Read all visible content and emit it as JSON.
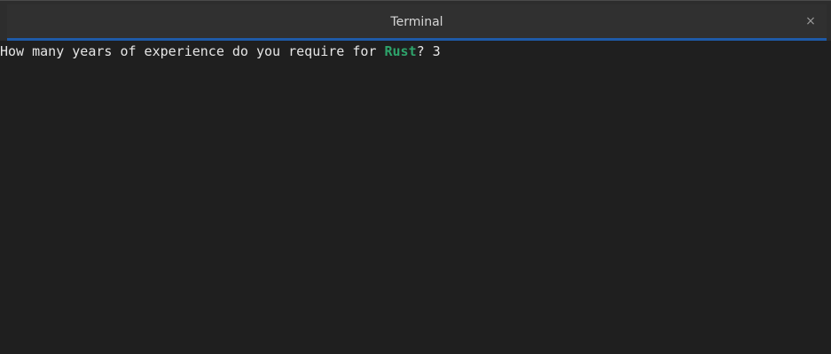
{
  "window": {
    "title": "Terminal",
    "close_glyph": "×",
    "accent_color": "#1e5aa8"
  },
  "terminal": {
    "prompt_before": "How many years of experience do you require for ",
    "highlight_word": "Rust",
    "highlight_color": "#2ea36b",
    "prompt_after": "? ",
    "answer": "3"
  }
}
